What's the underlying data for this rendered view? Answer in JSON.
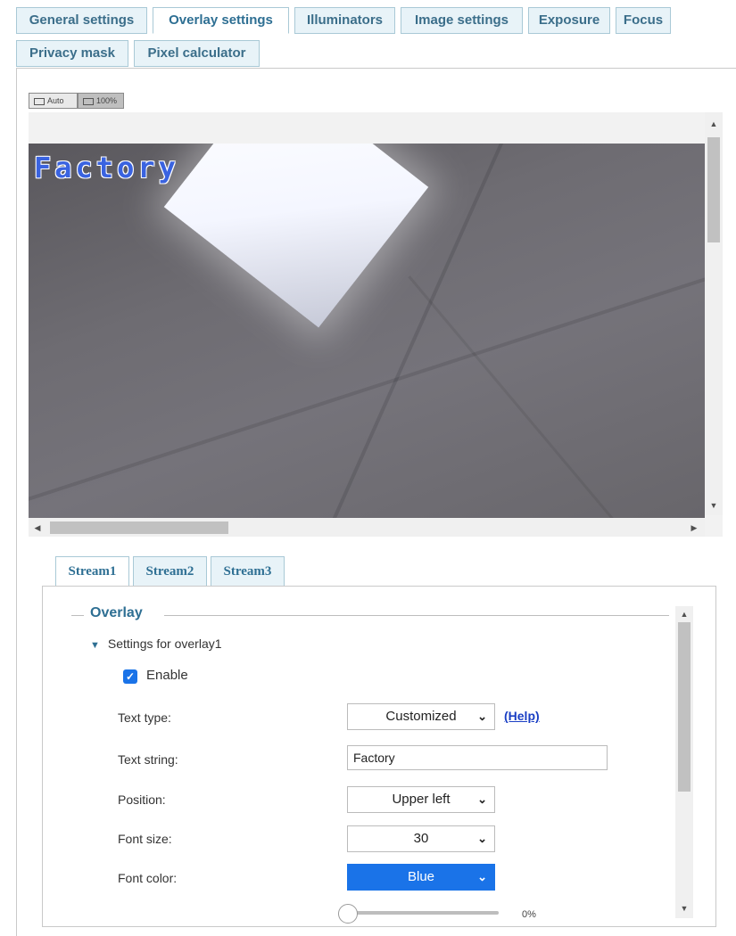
{
  "tabs": {
    "row1": [
      "General settings",
      "Overlay settings",
      "Illuminators",
      "Image settings",
      "Exposure",
      "Focus"
    ],
    "row2": [
      "Privacy mask",
      "Pixel calculator"
    ],
    "active": "Overlay settings"
  },
  "view_buttons": {
    "auto": "Auto",
    "full": "100%"
  },
  "video": {
    "overlay_text": "Factory",
    "overlay_color": "#3a63e0"
  },
  "stream_tabs": [
    "Stream1",
    "Stream2",
    "Stream3"
  ],
  "panel": {
    "legend": "Overlay",
    "subsection": "Settings for overlay1",
    "enable": {
      "label": "Enable",
      "checked": true
    },
    "fields": {
      "text_type": {
        "label": "Text type:",
        "value": "Customized",
        "help": "(Help)"
      },
      "text_string": {
        "label": "Text string:",
        "value": "Factory"
      },
      "position": {
        "label": "Position:",
        "value": "Upper left"
      },
      "font_size": {
        "label": "Font size:",
        "value": "30"
      },
      "font_color": {
        "label": "Font color:",
        "value": "Blue"
      },
      "slider": {
        "value_text": "0%",
        "value": 0
      }
    }
  },
  "colors": {
    "accent": "#2e6f93",
    "select_blue": "#1a73e8",
    "tab_bg": "#e8f3f8"
  }
}
